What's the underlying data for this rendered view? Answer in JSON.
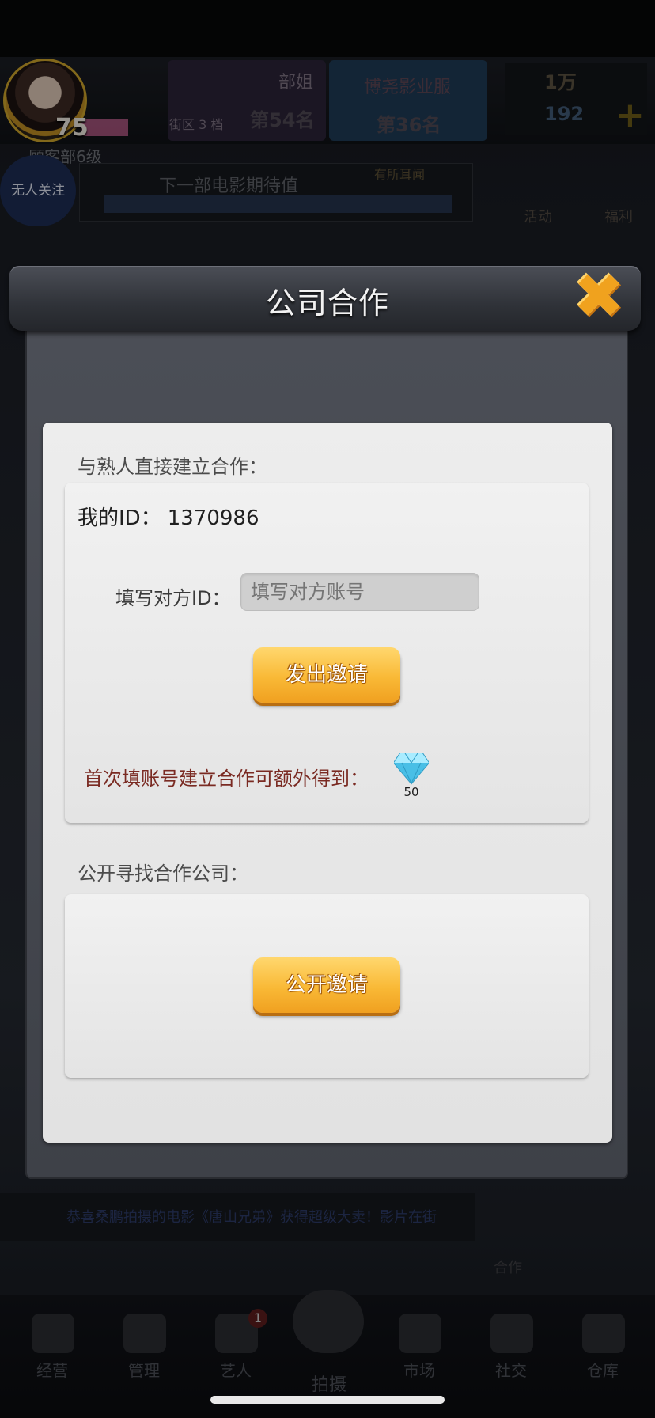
{
  "background": {
    "player_level": "75",
    "player_subtitle": "顾客部6级",
    "rank_left": {
      "title": "部姐",
      "district": "街区 3 档",
      "rank": "第54名"
    },
    "rank_right": {
      "title": "博尧影业服",
      "rank": "第36名"
    },
    "currency": {
      "coins": "1万",
      "gems": "192"
    },
    "follow_button": "无人关注",
    "marquee": {
      "text": "下一部电影期待值",
      "status": "有所耳闻"
    },
    "side_activity": "活动",
    "side_welfare": "福利",
    "news_ticker": "恭喜桑鹏拍摄的电影《唐山兄弟》获得超级大卖！影片在街",
    "cooperation_label": "合作",
    "bottom_nav": [
      "经营",
      "管理",
      "艺人",
      "拍摄",
      "市场",
      "社交",
      "仓库"
    ],
    "artist_badge": "1"
  },
  "dialog": {
    "title": "公司合作",
    "direct_section_label": "与熟人直接建立合作：",
    "my_id_label": "我的ID：",
    "my_id_value": "1370986",
    "fill_id_label": "填写对方ID：",
    "fill_id_placeholder": "填写对方账号",
    "send_invite_button": "发出邀请",
    "reward_text": "首次填账号建立合作可额外得到：",
    "reward_gem_count": "50",
    "public_section_label": "公开寻找合作公司：",
    "public_invite_button": "公开邀请"
  },
  "colors": {
    "button_gold": "#f9b936",
    "reward_text": "#7a2a22",
    "gem": "#6fd3f2"
  }
}
